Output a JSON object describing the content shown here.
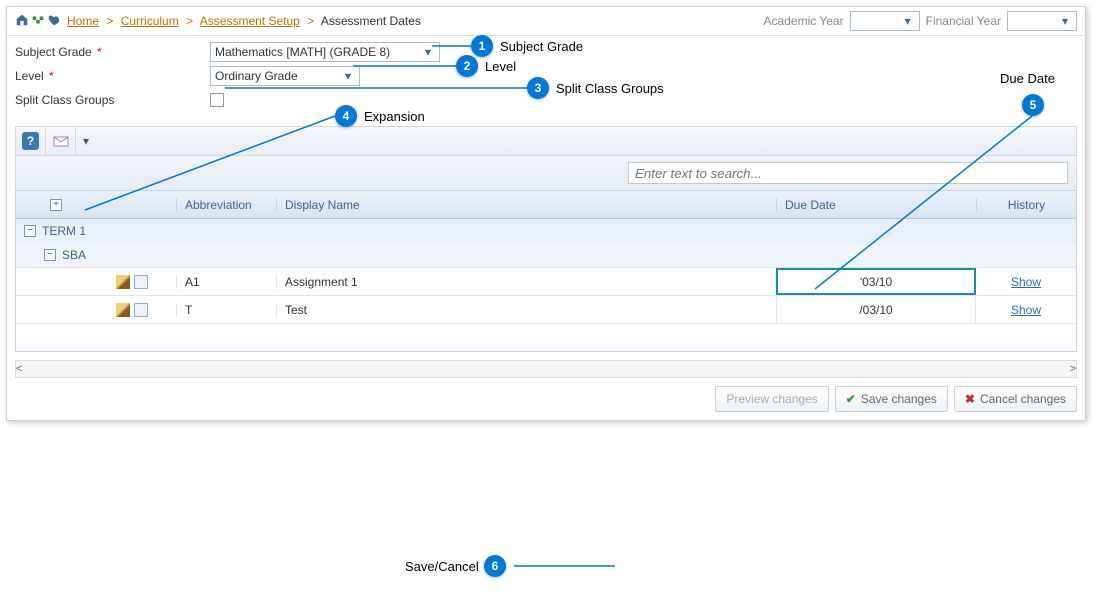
{
  "breadcrumb": {
    "home": "Home",
    "l1": "Curriculum",
    "l2": "Assessment Setup",
    "l3": "Assessment Dates"
  },
  "yearbar": {
    "acad_label": "Academic Year",
    "fin_label": "Financial Year",
    "acad_value": "",
    "fin_value": ""
  },
  "form": {
    "subject_grade_label": "Subject Grade",
    "subject_grade_value": "Mathematics [MATH] (GRADE 8)",
    "level_label": "Level",
    "level_value": "Ordinary Grade",
    "split_label": "Split Class Groups",
    "split_checked": false
  },
  "search": {
    "placeholder": "Enter text to search..."
  },
  "grid": {
    "headers": {
      "abbr": "Abbreviation",
      "dname": "Display Name",
      "due": "Due Date",
      "hist": "History"
    },
    "groups": [
      {
        "label": "TERM 1",
        "sub": [
          {
            "label": "SBA",
            "rows": [
              {
                "abbr": "A1",
                "dname": "Assignment 1",
                "due": "'03/10",
                "hist": "Show",
                "selected": true
              },
              {
                "abbr": "T",
                "dname": "Test",
                "due": "/03/10",
                "hist": "Show",
                "selected": false
              }
            ]
          }
        ]
      }
    ]
  },
  "actions": {
    "preview": "Preview changes",
    "save": "Save changes",
    "cancel": "Cancel changes"
  },
  "annotations": {
    "1": "Subject Grade",
    "2": "Level",
    "3": "Split Class Groups",
    "4": "Expansion",
    "5": "Due Date",
    "6": "Save/Cancel"
  }
}
